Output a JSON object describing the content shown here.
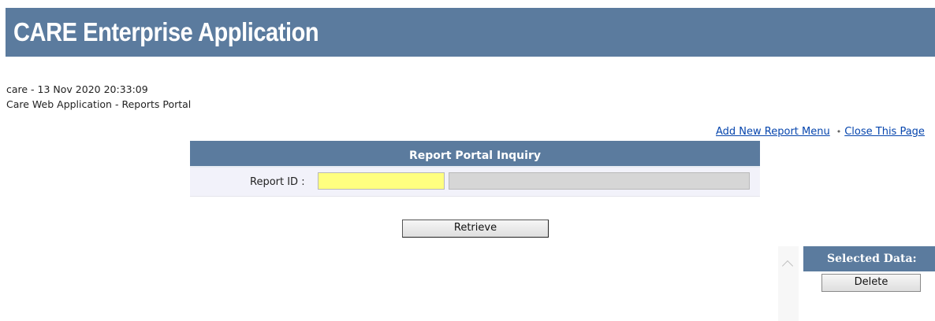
{
  "header": {
    "title": "CARE Enterprise Application",
    "accent_color": "#5b7b9e"
  },
  "session": {
    "user_timestamp": "care - 13 Nov 2020 20:33:09",
    "portal_title": "Care Web Application - Reports Portal"
  },
  "links": {
    "add_new_report_menu": "Add New Report Menu",
    "separator": "•",
    "close_this_page": "Close This Page"
  },
  "inquiry": {
    "heading": "Report Portal Inquiry",
    "report_id_label": "Report ID :",
    "report_id_value": "",
    "report_id_color": "#ffff80",
    "description_value": ""
  },
  "actions": {
    "retrieve_label": "Retrieve"
  },
  "selected": {
    "heading": "Selected Data:",
    "delete_label": "Delete"
  },
  "icons": {
    "scroll_up": "chevron-up-icon"
  }
}
